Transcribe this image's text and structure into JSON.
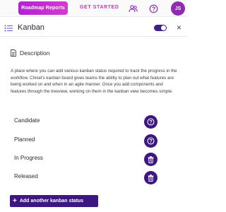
{
  "topbar": {
    "roadmap_reports_label": "Roadmap Reports",
    "get_started_label": "GET STARTED",
    "avatar_initials": "JS",
    "icons": [
      "users-icon",
      "help-circle-icon"
    ]
  },
  "header": {
    "title": "Kanban",
    "toggle_state": "on",
    "close_glyph": "×"
  },
  "description": {
    "heading": "Description",
    "text": "A place where you can add various kanban status required to track the progress in the workflow. Chisel's kanban board gives teams the ability to plan out what features are being worked on and when in an agile manner. Once you add components and features through the treeview, working on them in the kanban view becomes simple."
  },
  "statuses": [
    {
      "label": "Candidate",
      "action_icon": "help-circle-icon"
    },
    {
      "label": "Planned",
      "action_icon": "help-circle-icon"
    },
    {
      "label": "In Progress",
      "action_icon": "trash-icon"
    },
    {
      "label": "Released",
      "action_icon": "trash-icon"
    }
  ],
  "add_button": {
    "plus": "+",
    "label": "Add another kanban status"
  },
  "colors": {
    "brand_purple": "#3d1781",
    "accent_pink": "#c531c9",
    "avatar": "#8e2bb0"
  }
}
